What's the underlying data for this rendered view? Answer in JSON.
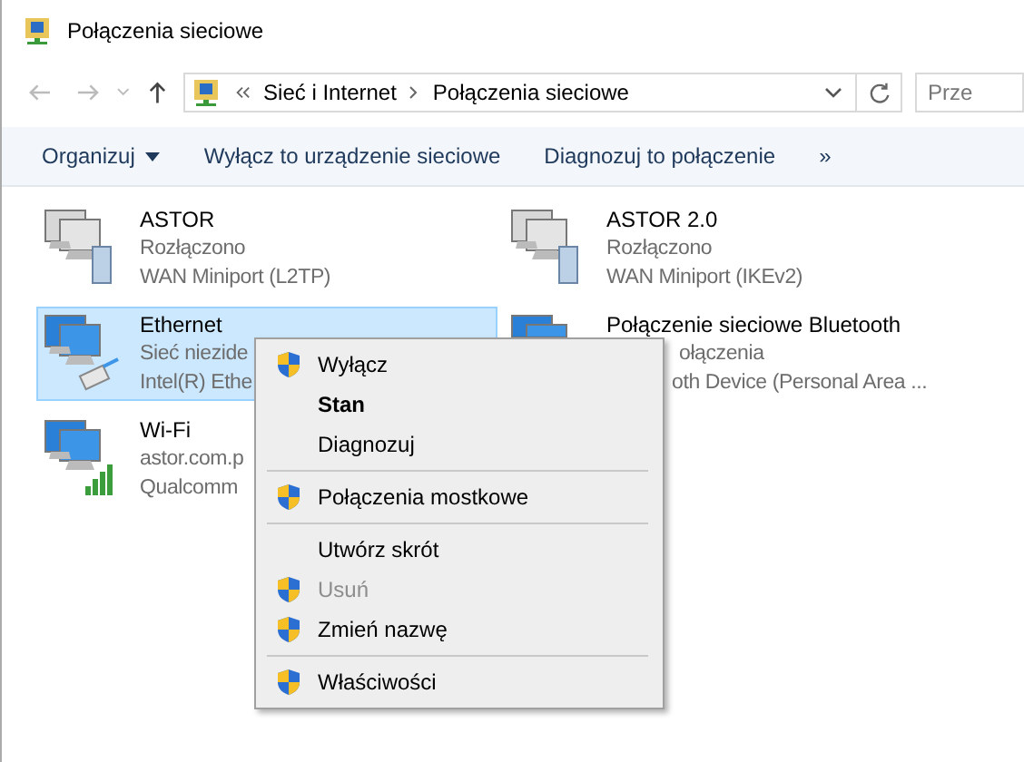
{
  "window": {
    "title": "Połączenia sieciowe"
  },
  "address": {
    "crumbs": [
      "Sieć i Internet",
      "Połączenia sieciowe"
    ]
  },
  "search": {
    "placeholder": "Prze"
  },
  "toolbar": {
    "items": [
      {
        "label": "Organizuj",
        "dropdown": true
      },
      {
        "label": "Wyłącz to urządzenie sieciowe",
        "dropdown": false
      },
      {
        "label": "Diagnozuj to połączenie",
        "dropdown": false
      }
    ],
    "more": "»"
  },
  "connections": [
    {
      "name": "ASTOR",
      "status": "Rozłączono",
      "device": "WAN Miniport (L2TP)",
      "kind": "wan",
      "selected": false
    },
    {
      "name": "ASTOR 2.0",
      "status": "Rozłączono",
      "device": "WAN Miniport (IKEv2)",
      "kind": "wan",
      "selected": false
    },
    {
      "name": "Ethernet",
      "status": "Sieć niezide",
      "device": "Intel(R) Ethe",
      "kind": "ethernet",
      "selected": true
    },
    {
      "name": "Połączenie sieciowe Bluetooth",
      "status": "ołączenia",
      "device": "oth Device (Personal Area ...",
      "kind": "bluetooth",
      "selected": false
    },
    {
      "name": "Wi-Fi",
      "status": "astor.com.p",
      "device": "Qualcomm",
      "kind": "wifi",
      "selected": false
    }
  ],
  "context_menu": [
    {
      "kind": "item",
      "label": "Wyłącz",
      "shield": true,
      "default": false,
      "disabled": false
    },
    {
      "kind": "item",
      "label": "Stan",
      "shield": false,
      "default": true,
      "disabled": false
    },
    {
      "kind": "item",
      "label": "Diagnozuj",
      "shield": false,
      "default": false,
      "disabled": false
    },
    {
      "kind": "separator"
    },
    {
      "kind": "item",
      "label": "Połączenia mostkowe",
      "shield": true,
      "default": false,
      "disabled": false
    },
    {
      "kind": "separator"
    },
    {
      "kind": "item",
      "label": "Utwórz skrót",
      "shield": false,
      "default": false,
      "disabled": false
    },
    {
      "kind": "item",
      "label": "Usuń",
      "shield": true,
      "default": false,
      "disabled": true
    },
    {
      "kind": "item",
      "label": "Zmień nazwę",
      "shield": true,
      "default": false,
      "disabled": false
    },
    {
      "kind": "separator"
    },
    {
      "kind": "item",
      "label": "Właściwości",
      "shield": true,
      "default": false,
      "disabled": false
    }
  ]
}
